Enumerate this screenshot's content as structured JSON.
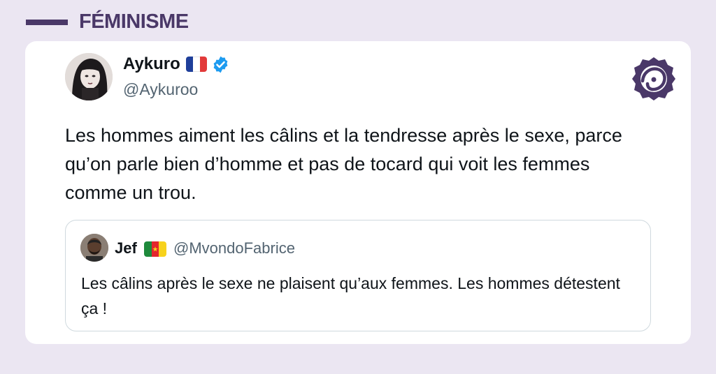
{
  "header": {
    "category": "FÉMINISME"
  },
  "tweet": {
    "author": {
      "display_name": "Aykuro",
      "flag": "flag-france-icon",
      "handle": "@Aykuroo",
      "verified": true
    },
    "text": "Les hommes aiment les câlins et la tendresse après le sexe, parce qu’on parle bien d’homme et pas de tocard qui voit les femmes comme un trou.",
    "quote": {
      "author": {
        "display_name": "Jef",
        "flag": "flag-cameroon-icon",
        "handle": "@MvondoFabrice"
      },
      "text": "Les câlins après le sexe ne plaisent qu’aux femmes. Les hommes détestent ça !"
    }
  },
  "colors": {
    "background": "#ebe6f2",
    "brand": "#4a3868",
    "verified_blue": "#1d9bf0",
    "text_primary": "#0f1419",
    "text_secondary": "#536471"
  },
  "icons": {
    "brand_logo": "brand-logo-icon",
    "verified": "verified-badge-icon"
  }
}
